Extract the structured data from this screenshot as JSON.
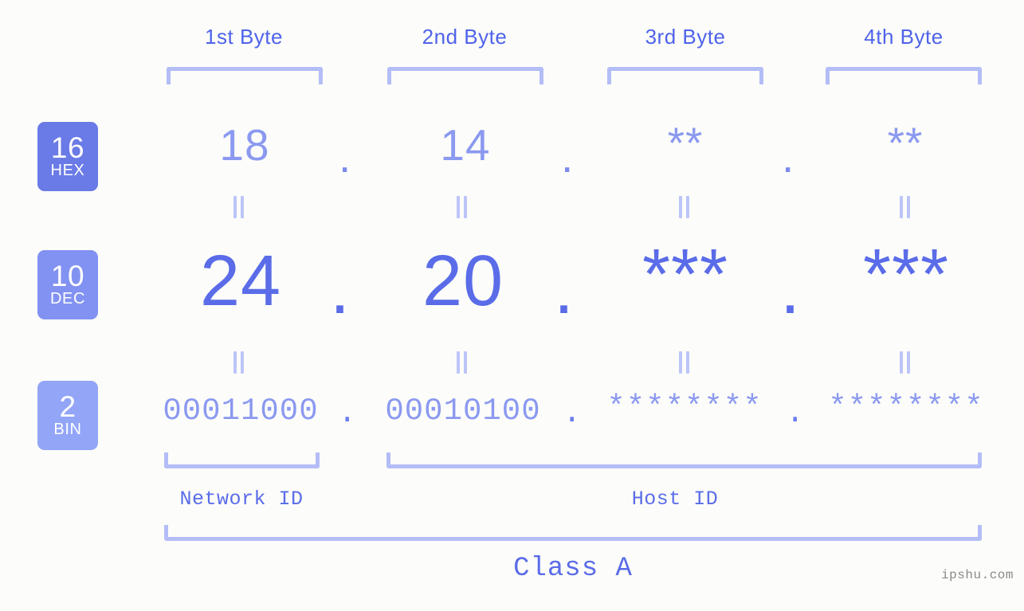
{
  "meta": {
    "background_color": "#fcfdfa",
    "accent_color": "#5a6ce8",
    "accent_light": "#8b99f0",
    "bracket_color": "#b3bdf7"
  },
  "header": {
    "bytes": [
      {
        "label": "1st Byte"
      },
      {
        "label": "2nd Byte"
      },
      {
        "label": "3rd Byte"
      },
      {
        "label": "4th Byte"
      }
    ]
  },
  "bases": [
    {
      "number": "16",
      "name": "HEX",
      "color": "#6a7ae6"
    },
    {
      "number": "10",
      "name": "DEC",
      "color": "#8292f2"
    },
    {
      "number": "2",
      "name": "BIN",
      "color": "#93a5f7"
    }
  ],
  "rows": {
    "hex": {
      "values": [
        "18",
        "14",
        "**",
        "**"
      ],
      "separator": "."
    },
    "dec": {
      "values": [
        "24",
        "20",
        "***",
        "***"
      ],
      "separator": "."
    },
    "bin": {
      "values": [
        "00011000",
        "00010100",
        "********",
        "********"
      ],
      "separator": "."
    }
  },
  "connectors": {
    "symbol": "="
  },
  "footer": {
    "network_id_label": "Network ID",
    "host_id_label": "Host ID",
    "class_label": "Class A",
    "watermark": "ipshu.com"
  }
}
